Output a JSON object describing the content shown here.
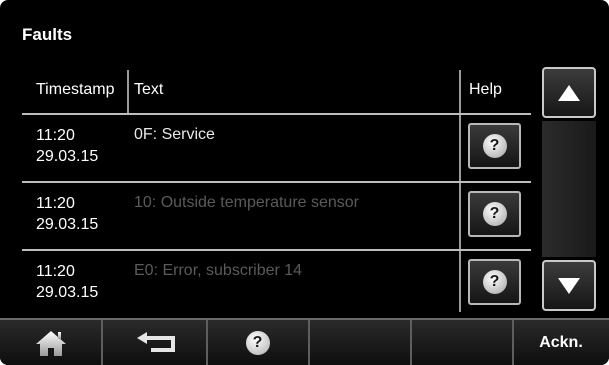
{
  "header": {
    "title": "Faults"
  },
  "table": {
    "columns": {
      "timestamp": "Timestamp",
      "text": "Text",
      "help": "Help"
    },
    "rows": [
      {
        "time": "11:20",
        "date": "29.03.15",
        "text": "0F: Service",
        "state": "active"
      },
      {
        "time": "11:20",
        "date": "29.03.15",
        "text": "10: Outside temperature sensor",
        "state": "dim"
      },
      {
        "time": "11:20",
        "date": "29.03.15",
        "text": "E0: Error, subscriber 14",
        "state": "dim"
      }
    ],
    "help_icon": "question-icon"
  },
  "scroll": {
    "up_icon": "triangle-up-icon",
    "down_icon": "triangle-down-icon"
  },
  "footer": {
    "home_icon": "home-icon",
    "back_icon": "return-arrow-icon",
    "help_icon": "question-icon",
    "ackn_label": "Ackn."
  },
  "colors": {
    "background": "#000000",
    "active_text": "#e8e8e8",
    "dim_text": "#5a5a5a"
  }
}
